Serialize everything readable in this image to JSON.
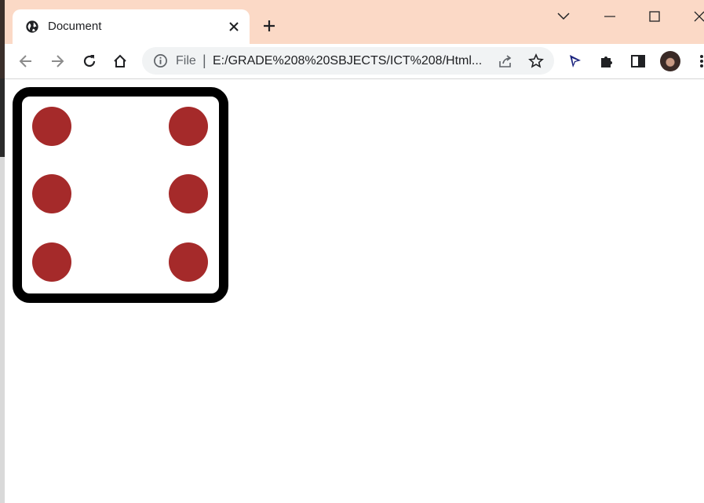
{
  "tab": {
    "title": "Document"
  },
  "toolbar": {
    "scheme_label": "File",
    "separator": "|",
    "url": "E:/GRADE%208%20SBJECTS/ICT%208/Html..."
  },
  "icons": {
    "favicon": "globe-icon",
    "tab_close": "close-icon",
    "new_tab": "plus-icon",
    "back": "arrow-left-icon",
    "forward": "arrow-right-icon",
    "reload": "reload-icon",
    "home": "home-icon",
    "info": "info-icon",
    "share": "share-icon",
    "bookmark": "star-icon",
    "extensions": [
      "cursor-icon",
      "puzzle-icon",
      "side-panel-icon"
    ],
    "menu": "kebab-menu-icon"
  },
  "dice": {
    "face_value": 6,
    "dot_color": "#a52a2a",
    "border_color": "#000000"
  },
  "colors": {
    "tabbar_bg": "#fbd9c6",
    "omnibox_bg": "#f1f3f4"
  }
}
